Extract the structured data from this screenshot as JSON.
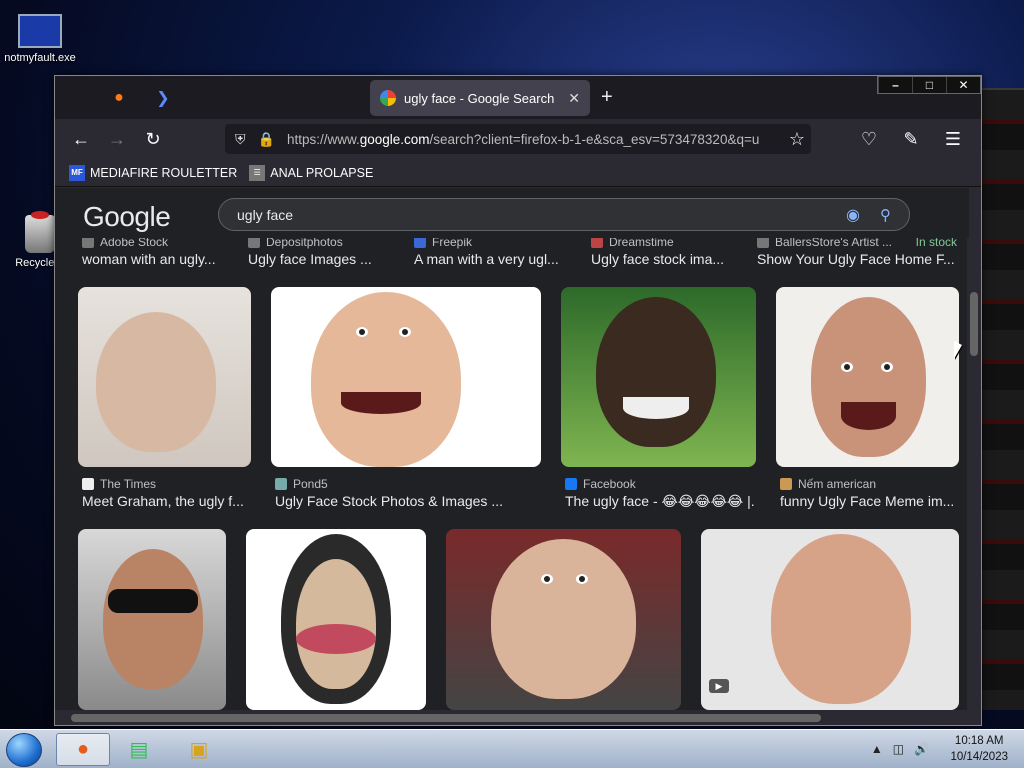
{
  "desktop": {
    "icons": [
      {
        "label": "notmyfault.exe"
      },
      {
        "label": "Recycle B"
      }
    ]
  },
  "window": {
    "controls": {
      "minimize": "–",
      "maximize": "□",
      "close": "✕"
    }
  },
  "browser": {
    "tab": {
      "title": "ugly face - Google Search",
      "close": "✕"
    },
    "newtab": "+",
    "url": {
      "prefix": "https://www.",
      "domain": "google.com",
      "rest": "/search?client=firefox-b-1-e&sca_esv=573478320&q=u"
    },
    "bookmarks": [
      {
        "label": "MEDIAFIRE ROULETTER",
        "favicon": "MF"
      },
      {
        "label": "ANAL PROLAPSE",
        "favicon": "☰"
      }
    ]
  },
  "google": {
    "logo": "Google",
    "query": "ugly face"
  },
  "results": {
    "row0": [
      {
        "source": "Adobe Stock",
        "title": "woman with an ugly..."
      },
      {
        "source": "Depositphotos",
        "title": "Ugly face Images ..."
      },
      {
        "source": "Freepik",
        "title": "A man with a very ugl..."
      },
      {
        "source": "Dreamstime",
        "title": "Ugly face stock ima..."
      },
      {
        "source": "BallersStore's Artist ...",
        "title": "Show Your Ugly Face Home F...",
        "badge": "In stock"
      }
    ],
    "row1": [
      {
        "source": "The Times",
        "title": "Meet Graham, the ugly f..."
      },
      {
        "source": "Pond5",
        "title": "Ugly Face Stock Photos & Images ..."
      },
      {
        "source": "Facebook",
        "title": "The ugly face - 😂😂😂😂😂 |..."
      },
      {
        "source": "Nếm american",
        "title": "funny Ugly Face Meme im..."
      }
    ]
  },
  "taskbar": {
    "time": "10:18 AM",
    "date": "10/14/2023"
  }
}
